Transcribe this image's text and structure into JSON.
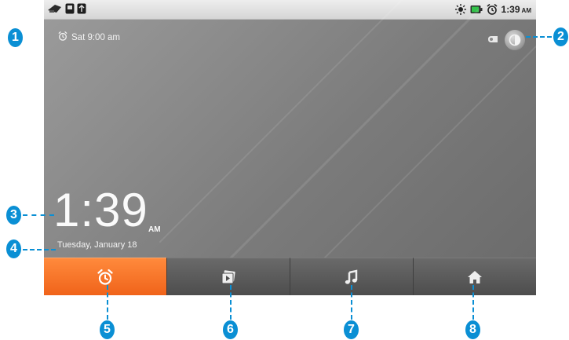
{
  "status_bar": {
    "time": "1:39",
    "ampm": "AM",
    "left_icons": [
      "usb-icon",
      "sd-card-icon",
      "usb-debug-icon"
    ],
    "right_icons": [
      "brightness-icon",
      "battery-icon",
      "alarm-icon"
    ]
  },
  "home": {
    "alarm": "Sat 9:00 am",
    "clock_time": "1:39",
    "clock_ampm": "AM",
    "date": "Tuesday, January 18"
  },
  "toolbar": {
    "buttons": [
      {
        "icon": "alarm-clock-icon",
        "active": true
      },
      {
        "icon": "slideshow-icon",
        "active": false
      },
      {
        "icon": "music-icon",
        "active": false
      },
      {
        "icon": "home-icon",
        "active": false
      }
    ]
  },
  "callouts": {
    "c1": "1",
    "c2": "2",
    "c3": "3",
    "c4": "4",
    "c5": "5",
    "c6": "6",
    "c7": "7",
    "c8": "8"
  },
  "colors": {
    "accent": "#f0631a",
    "callout": "#0a8fd4"
  }
}
